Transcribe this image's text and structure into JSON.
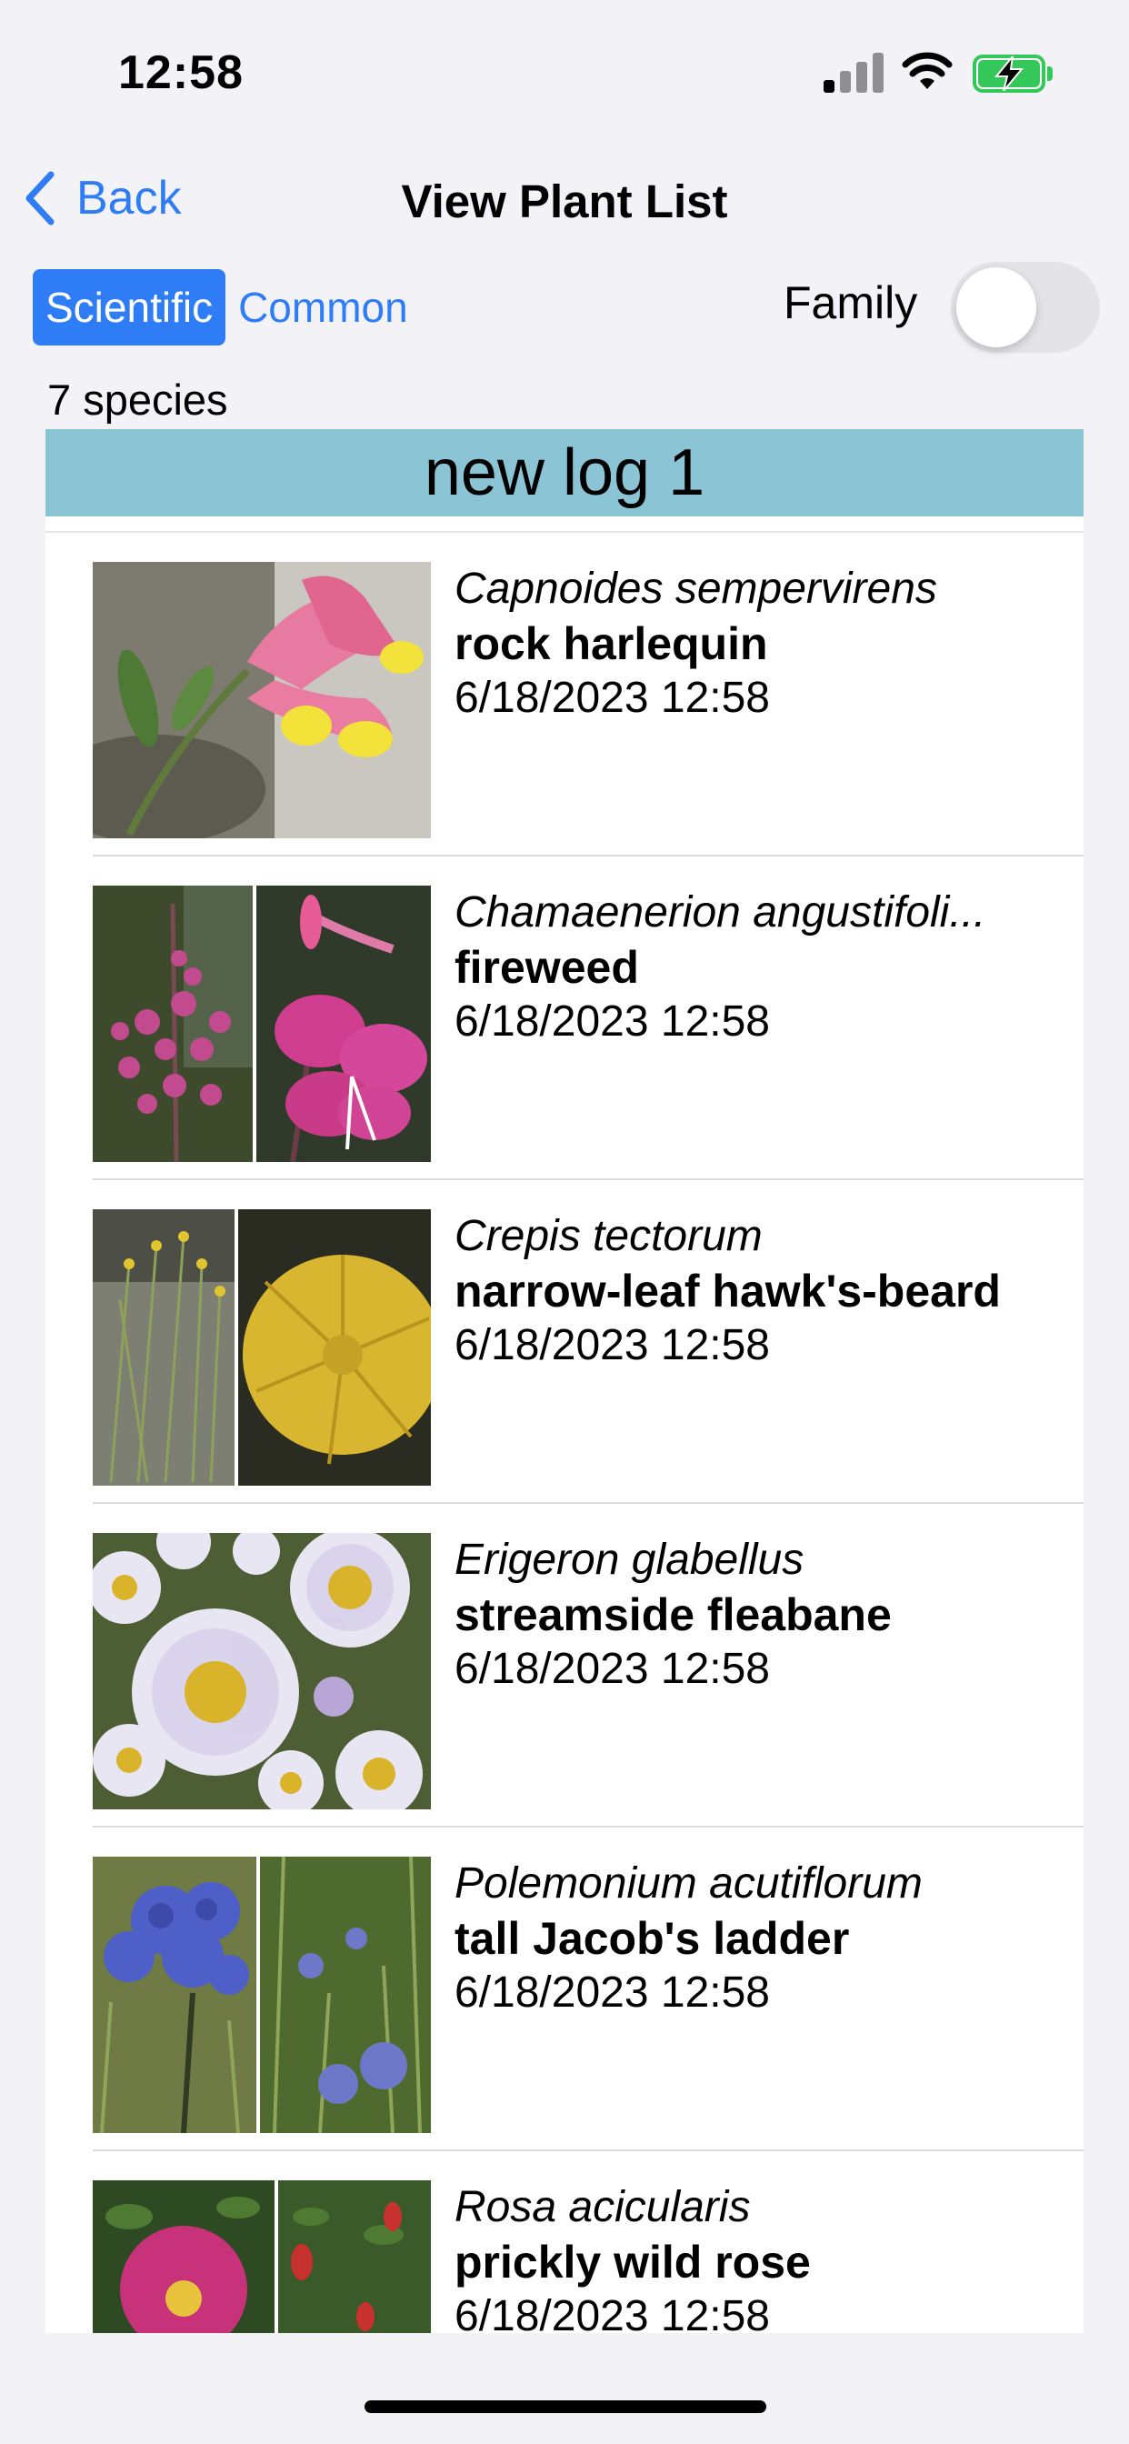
{
  "status_bar": {
    "time": "12:58"
  },
  "nav": {
    "back_label": "Back",
    "title": "View Plant List"
  },
  "controls": {
    "scientific_label": "Scientific",
    "common_label": "Common",
    "family_label": "Family",
    "family_on": false
  },
  "species_count": "7 species",
  "log_title": "new log 1",
  "plants": [
    {
      "scientific": "Capnoides sempervirens",
      "common": "rock harlequin",
      "date": "6/18/2023 12:58"
    },
    {
      "scientific": "Chamaenerion angustifoli...",
      "common": "fireweed",
      "date": "6/18/2023 12:58"
    },
    {
      "scientific": "Crepis tectorum",
      "common": "narrow-leaf hawk's-beard",
      "date": "6/18/2023 12:58"
    },
    {
      "scientific": "Erigeron glabellus",
      "common": "streamside fleabane",
      "date": "6/18/2023 12:58"
    },
    {
      "scientific": "Polemonium acutiflorum",
      "common": "tall Jacob's ladder",
      "date": "6/18/2023 12:58"
    },
    {
      "scientific": "Rosa acicularis",
      "common": "prickly wild rose",
      "date": "6/18/2023 12:58"
    }
  ],
  "colors": {
    "accent": "#2f7df6",
    "log_header": "#8bc4d4",
    "battery": "#34c759"
  }
}
